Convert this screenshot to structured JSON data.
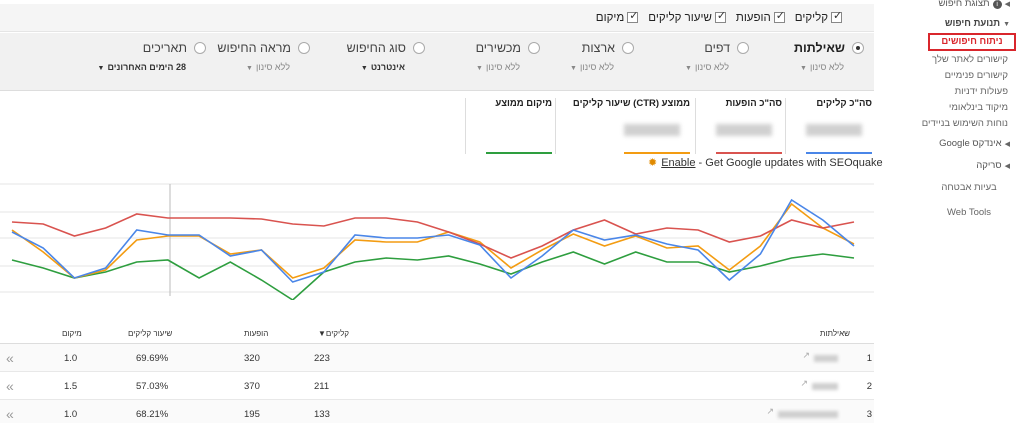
{
  "sidebar": {
    "items": [
      {
        "label": "תצוגת חיפוש",
        "icon": "info-icon"
      },
      {
        "label": "תנועת חיפוש"
      },
      {
        "label": "ניתוח חיפושים"
      },
      {
        "label": "קישורים לאתר שלך"
      },
      {
        "label": "קישורים פנימיים"
      },
      {
        "label": "פעולות ידניות"
      },
      {
        "label": "מיקוד בינלאומי"
      },
      {
        "label": "נוחות השימוש בניידים"
      },
      {
        "label": "אינדקס Google"
      },
      {
        "label": "סריקה"
      },
      {
        "label": "בעיות אבטחה"
      },
      {
        "label": "Web Tools"
      }
    ]
  },
  "metrics": [
    {
      "label": "קליקים",
      "checked": true
    },
    {
      "label": "הופעות",
      "checked": true
    },
    {
      "label": "שיעור קליקים",
      "checked": true
    },
    {
      "label": "מיקום",
      "checked": true
    }
  ],
  "filters": [
    {
      "label": "שאילתות",
      "value": "ללא סינון",
      "selected": true
    },
    {
      "label": "דפים",
      "value": "ללא סינון"
    },
    {
      "label": "ארצות",
      "value": "ללא סינון"
    },
    {
      "label": "מכשירים",
      "value": "ללא סינון"
    },
    {
      "label": "סוג החיפוש",
      "value": "אינטרנט"
    },
    {
      "label": "מראה החיפוש",
      "value": "ללא סינון"
    },
    {
      "label": "תאריכים",
      "value": "28 הימים האחרונים"
    }
  ],
  "totals": [
    {
      "label": "סה\"כ קליקים",
      "color": "#4a86e8"
    },
    {
      "label": "סה\"כ הופעות",
      "color": "#d9534f"
    },
    {
      "label": "שיעור קליקים (CTR) ממוצע",
      "color": "#f39c12"
    },
    {
      "label": "מיקום ממוצע",
      "color": "#2e9e3f"
    }
  ],
  "seoquake": {
    "link": "Enable",
    "text": "- Get Google updates with SEOquake"
  },
  "chart_data": {
    "type": "line",
    "series": [
      {
        "name": "קליקים",
        "color": "#4a86e8",
        "values": [
          58,
          42,
          12,
          22,
          60,
          55,
          55,
          34,
          40,
          8,
          18,
          55,
          52,
          52,
          55,
          45,
          12,
          34,
          60,
          50,
          55,
          46,
          40,
          10,
          36,
          90,
          70,
          44
        ]
      },
      {
        "name": "הופעות",
        "color": "#d9534f",
        "values": [
          68,
          66,
          54,
          62,
          76,
          72,
          72,
          72,
          71,
          66,
          64,
          72,
          72,
          68,
          58,
          46,
          32,
          44,
          60,
          70,
          56,
          62,
          60,
          48,
          54,
          70,
          62,
          68
        ]
      },
      {
        "name": "שיעור קליקים",
        "color": "#f39c12",
        "values": [
          60,
          38,
          12,
          20,
          50,
          54,
          54,
          36,
          40,
          12,
          22,
          50,
          48,
          48,
          58,
          48,
          22,
          40,
          56,
          44,
          54,
          42,
          44,
          20,
          44,
          86,
          62,
          46
        ]
      },
      {
        "name": "מיקום",
        "color": "#2e9e3f",
        "values": [
          30,
          22,
          12,
          18,
          28,
          30,
          12,
          28,
          10,
          -10,
          18,
          28,
          32,
          30,
          34,
          26,
          16,
          28,
          38,
          26,
          38,
          28,
          28,
          18,
          24,
          32,
          36,
          32
        ]
      }
    ]
  },
  "table": {
    "headers": {
      "query": "שאילתות",
      "clicks": "קליקים",
      "impressions": "הופעות",
      "ctr": "שיעור קליקים",
      "position": "מיקום"
    },
    "sort_indicator": "▼",
    "rows": [
      {
        "num": "1",
        "clicks": "223",
        "impressions": "320",
        "ctr": "69.69%",
        "position": "1.0"
      },
      {
        "num": "2",
        "clicks": "211",
        "impressions": "370",
        "ctr": "57.03%",
        "position": "1.5"
      },
      {
        "num": "3",
        "clicks": "133",
        "impressions": "195",
        "ctr": "68.21%",
        "position": "1.0"
      }
    ]
  }
}
